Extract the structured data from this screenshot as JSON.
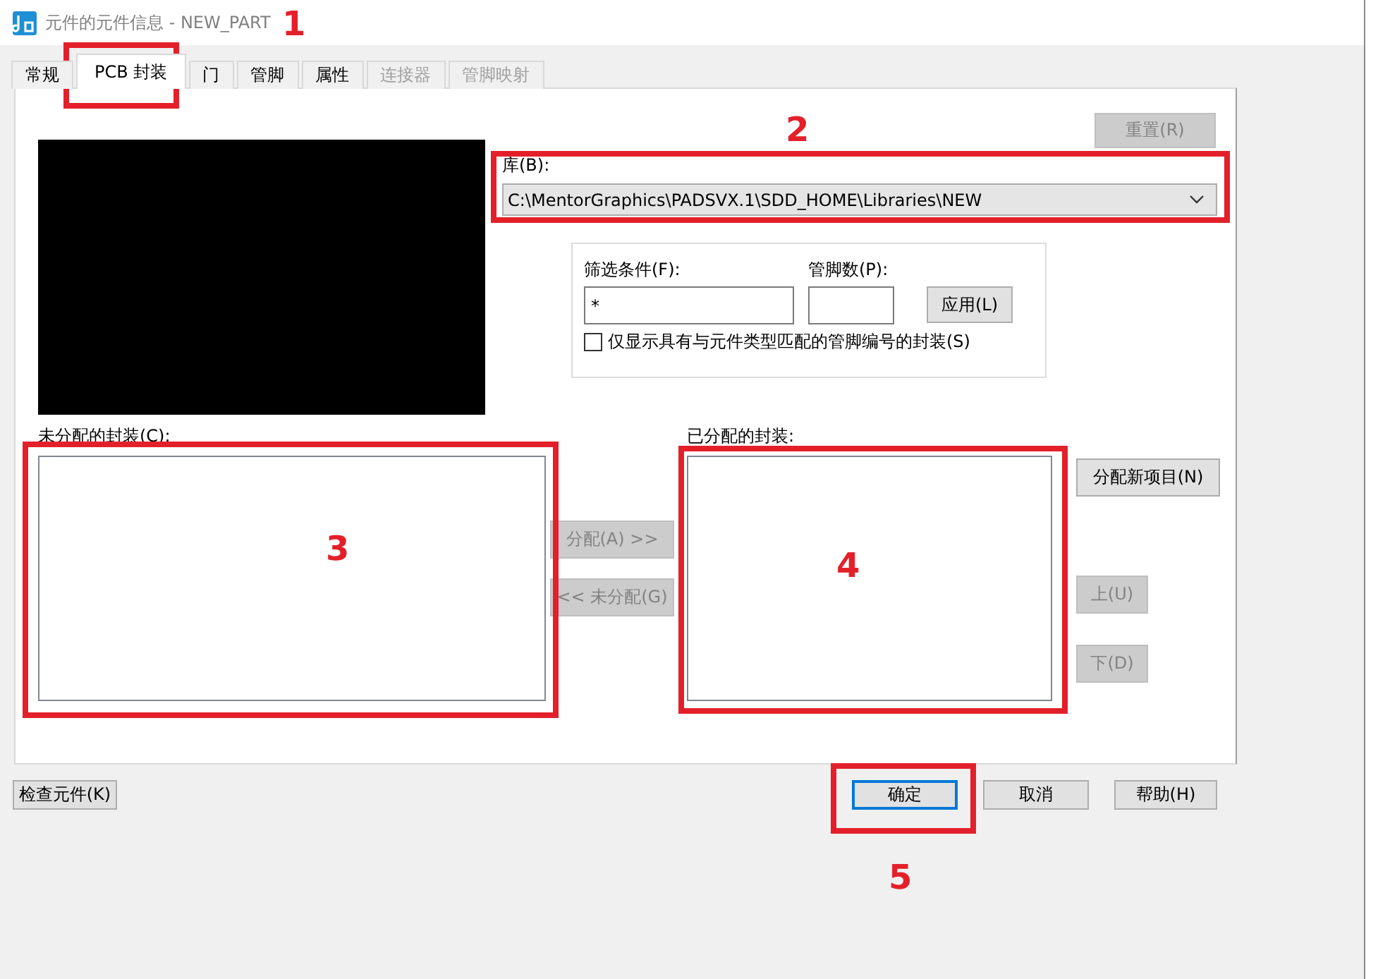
{
  "window": {
    "title": "元件的元件信息 - NEW_PART"
  },
  "tabs": [
    {
      "label": "常规",
      "selected": false,
      "disabled": false
    },
    {
      "label": "PCB 封装",
      "selected": true,
      "disabled": false
    },
    {
      "label": "门",
      "selected": false,
      "disabled": false
    },
    {
      "label": "管脚",
      "selected": false,
      "disabled": false
    },
    {
      "label": "属性",
      "selected": false,
      "disabled": false
    },
    {
      "label": "连接器",
      "selected": false,
      "disabled": true
    },
    {
      "label": "管脚映射",
      "selected": false,
      "disabled": true
    }
  ],
  "reset_button": {
    "label": "重置(R)",
    "disabled": true
  },
  "library": {
    "label": "库(B):",
    "value": "C:\\MentorGraphics\\PADSVX.1\\SDD_HOME\\Libraries\\NEW"
  },
  "filter": {
    "label": "筛选条件(F):",
    "value": "*"
  },
  "pin_count": {
    "label": "管脚数(P):"
  },
  "apply_button": {
    "label": "应用(L)",
    "disabled": false
  },
  "match_checkbox": {
    "label": "仅显示具有与元件类型匹配的管脚编号的封装(S)",
    "checked": false
  },
  "unassigned": {
    "label": "未分配的封装(C):"
  },
  "transfer_buttons": [
    {
      "label": "分配(A) >>",
      "disabled": true
    },
    {
      "label": "<< 未分配(G)",
      "disabled": true
    }
  ],
  "assigned": {
    "label": "已分配的封装:"
  },
  "side_buttons": [
    {
      "label": "分配新项目(N)",
      "disabled": false
    },
    {
      "label": "上(U)",
      "disabled": true
    },
    {
      "label": "下(D)",
      "disabled": true
    }
  ],
  "footer_buttons": [
    {
      "label": "检查元件(K)",
      "default": false
    },
    {
      "label": "确定",
      "default": true
    },
    {
      "label": "取消",
      "default": false
    },
    {
      "label": "帮助(H)",
      "default": false
    }
  ],
  "annotations": [
    {
      "number": "1"
    },
    {
      "number": "2"
    },
    {
      "number": "3"
    },
    {
      "number": "4"
    },
    {
      "number": "5"
    }
  ]
}
